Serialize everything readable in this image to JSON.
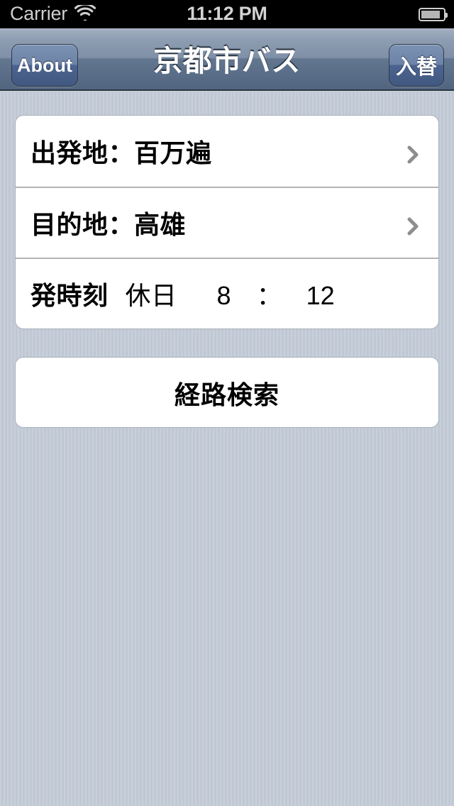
{
  "status_bar": {
    "carrier": "Carrier",
    "wifi_icon": "wifi-icon",
    "time": "11:12 PM",
    "battery_icon": "battery-icon"
  },
  "nav_bar": {
    "title": "京都市バス",
    "left_button": "About",
    "right_button": "入替"
  },
  "form": {
    "rows": [
      {
        "label": "出発地：百万遍",
        "accessory": "chevron-right-icon"
      },
      {
        "label": "目的地：高雄",
        "accessory": "chevron-right-icon"
      }
    ],
    "time_row": {
      "heading": "発時刻",
      "day_type": "休日",
      "hour": "8",
      "separator": "：",
      "minute": "12"
    }
  },
  "actions": {
    "search_label": "経路検索"
  },
  "colors": {
    "background": "#c3cbd6",
    "nav_bar_top": "#b2bccb",
    "nav_bar_bottom": "#51657f",
    "card_background": "#ffffff",
    "separator": "#b4b4b4",
    "chevron": "#8e8e8e",
    "status_bar": "#000000",
    "nav_button": "#6c82a7"
  }
}
